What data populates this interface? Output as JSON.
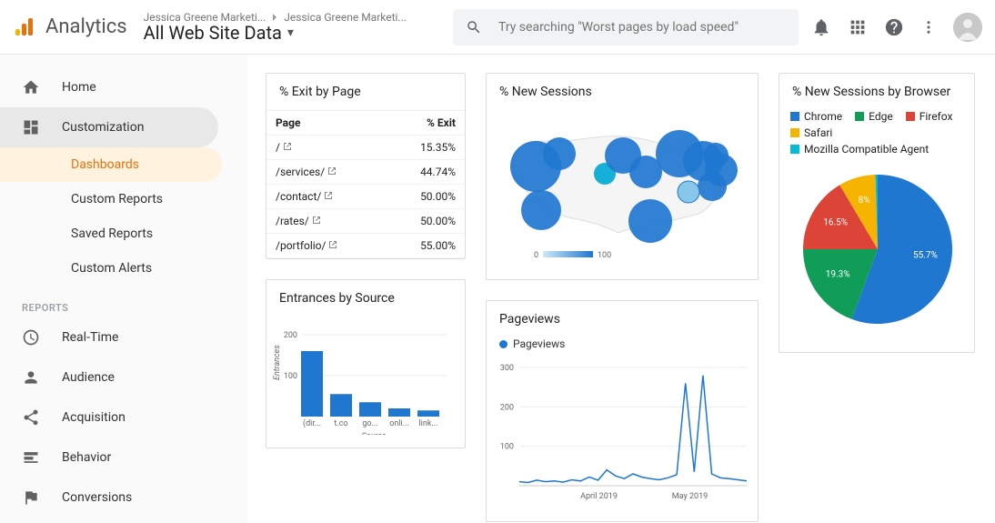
{
  "header": {
    "brand": "Analytics",
    "crumb1": "Jessica Greene Marketi...",
    "crumb2": "Jessica Greene Marketi...",
    "view": "All Web Site Data",
    "search_placeholder": "Try searching \"Worst pages by load speed\""
  },
  "sidebar": {
    "home": "Home",
    "customization": "Customization",
    "subs": {
      "dashboards": "Dashboards",
      "custom_reports": "Custom Reports",
      "saved_reports": "Saved Reports",
      "custom_alerts": "Custom Alerts"
    },
    "reports_hdr": "REPORTS",
    "realtime": "Real-Time",
    "audience": "Audience",
    "acquisition": "Acquisition",
    "behavior": "Behavior",
    "conversions": "Conversions"
  },
  "cards": {
    "exit_title": "% Exit by Page",
    "exit_headers": {
      "page": "Page",
      "exit": "% Exit"
    },
    "exit_rows": [
      {
        "page": "/",
        "exit": "15.35%"
      },
      {
        "page": "/services/",
        "exit": "44.74%"
      },
      {
        "page": "/contact/",
        "exit": "50.00%"
      },
      {
        "page": "/rates/",
        "exit": "50.00%"
      },
      {
        "page": "/portfolio/",
        "exit": "55.00%"
      }
    ],
    "ent_title": "Entrances by Source",
    "map_title": "% New Sessions",
    "pv_title": "Pageviews",
    "pv_legend": "Pageviews",
    "pie_title": "% New Sessions by Browser",
    "pie_legend": {
      "chrome": "Chrome",
      "edge": "Edge",
      "firefox": "Firefox",
      "safari": "Safari",
      "mozilla": "Mozilla Compatible Agent"
    }
  },
  "chart_data": [
    {
      "type": "bar",
      "title": "Entrances by Source",
      "ylabel": "Entrances",
      "xlabel": "Source",
      "y_ticks": [
        100,
        200
      ],
      "categories": [
        "(dir...",
        "t.co",
        "go...",
        "onli...",
        "link..."
      ],
      "values": [
        160,
        55,
        35,
        20,
        15
      ]
    },
    {
      "type": "map",
      "title": "% New Sessions",
      "scale_min": 0,
      "scale_max": 100
    },
    {
      "type": "line",
      "title": "Pageviews",
      "ylabel": "",
      "y_ticks": [
        100,
        200,
        300
      ],
      "x_labels": [
        "April 2019",
        "May 2019"
      ],
      "series": [
        {
          "name": "Pageviews",
          "values": [
            10,
            8,
            14,
            10,
            12,
            9,
            15,
            12,
            22,
            14,
            40,
            25,
            18,
            30,
            22,
            18,
            15,
            20,
            28,
            260,
            35,
            280,
            30,
            20,
            18,
            15,
            12
          ]
        }
      ]
    },
    {
      "type": "pie",
      "title": "% New Sessions by Browser",
      "slices": [
        {
          "name": "Chrome",
          "value": 55.7,
          "color": "#1f77d0"
        },
        {
          "name": "Edge",
          "value": 19.3,
          "color": "#0f9d58"
        },
        {
          "name": "Firefox",
          "value": 16.5,
          "color": "#db4437"
        },
        {
          "name": "Safari",
          "value": 8,
          "color": "#f4b400"
        },
        {
          "name": "Mozilla Compatible Agent",
          "value": 0.5,
          "color": "#00bcd4"
        }
      ]
    }
  ]
}
